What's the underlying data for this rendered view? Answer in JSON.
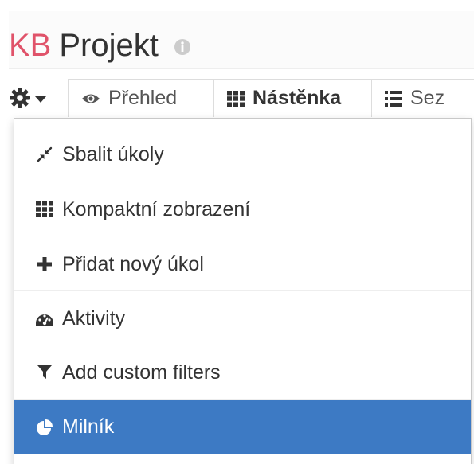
{
  "header": {
    "title_prefix": "KB",
    "title_name": "Projekt",
    "info_icon": "info-circle-icon"
  },
  "toolbar": {
    "settings_icon": "gear-icon",
    "caret_icon": "caret-down-icon"
  },
  "tabs": [
    {
      "label": "Přehled",
      "icon": "eye-icon",
      "active": false
    },
    {
      "label": "Nástěnka",
      "icon": "th-icon",
      "active": true
    },
    {
      "label": "Sez",
      "icon": "list-icon",
      "active": false
    }
  ],
  "menu": {
    "items": [
      {
        "label": "Sbalit úkoly",
        "icon": "compress-icon"
      },
      {
        "label": "Kompaktní zobrazení",
        "icon": "th-icon"
      },
      {
        "label": "Přidat nový úkol",
        "icon": "plus-icon"
      },
      {
        "label": "Aktivity",
        "icon": "dashboard-icon"
      },
      {
        "label": "Add custom filters",
        "icon": "filter-icon"
      },
      {
        "label": "Milník",
        "icon": "pie-chart-icon",
        "highlighted": true
      }
    ]
  },
  "colors": {
    "brand": "#e0536a",
    "highlight": "#3d7ac4"
  }
}
